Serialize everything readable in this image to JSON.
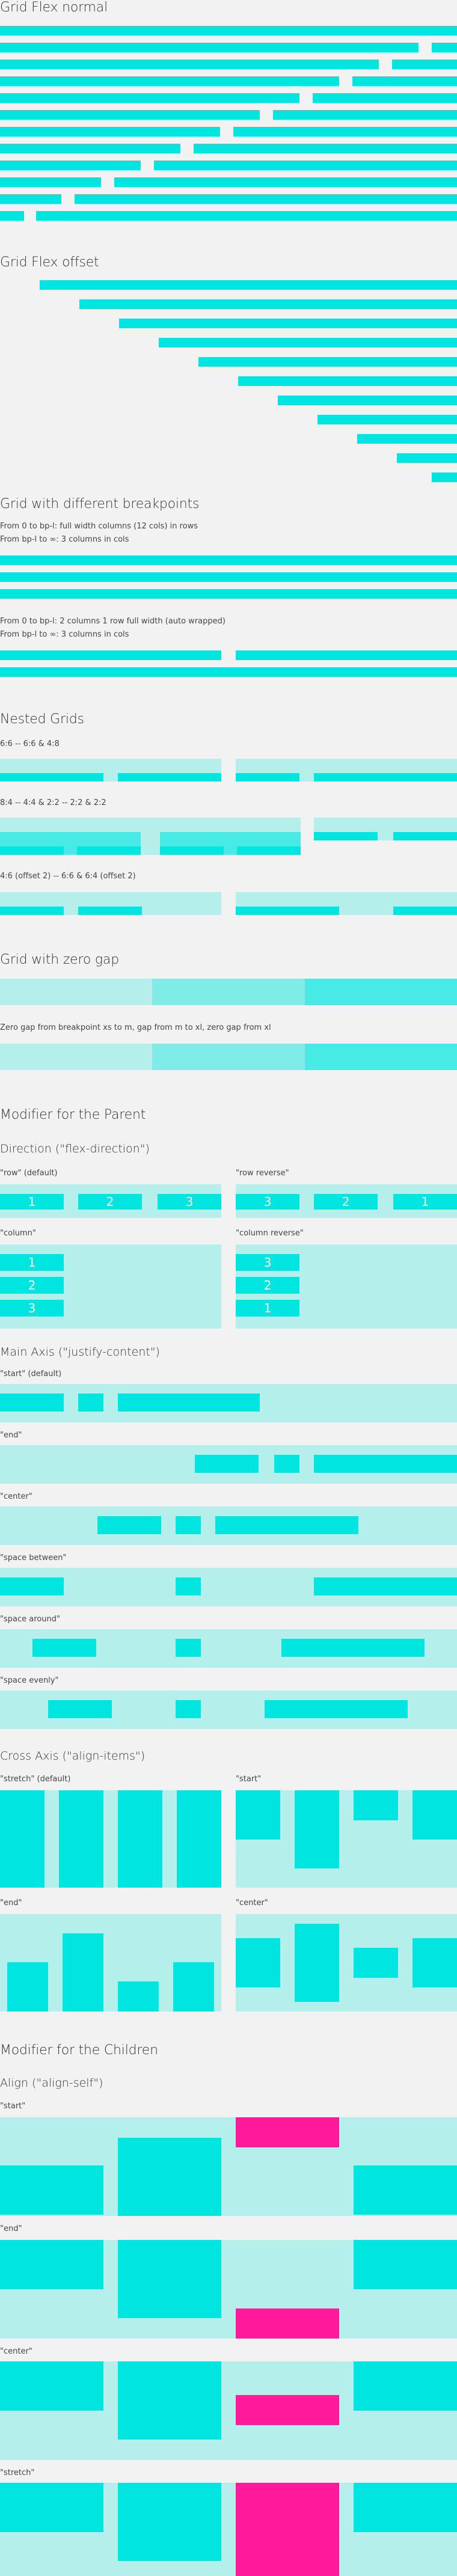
{
  "sections": {
    "grid_flex_normal": "Grid Flex normal",
    "grid_flex_offset": "Grid Flex offset",
    "breakpoints": {
      "title": "Grid with different breakpoints",
      "note1a": "From 0 to bp-l: full width columns (12 cols) in rows",
      "note1b": "From bp-l to ∞: 3 columns in cols",
      "note2a": "From 0 to bp-l: 2 columns 1 row full width (auto wrapped)",
      "note2b": "From bp-l to ∞: 3 columns in cols"
    },
    "nested": {
      "title": "Nested Grids",
      "label1": "6:6 -- 6:6 & 4:8",
      "label2": "8:4 -- 4:4 & 2:2 -- 2:2 & 2:2",
      "label3": "4:6 (offset 2) -- 6:6 & 6:4 (offset 2)"
    },
    "zero_gap": {
      "title": "Grid with zero gap",
      "note": "Zero gap from breakpoint xs to m, gap from m to xl, zero gap from xl"
    },
    "parent": {
      "title": "Modifier for the Parent",
      "direction": {
        "title": "Direction (\"flex-direction\")",
        "row": "\"row\" (default)",
        "row_reverse": "\"row reverse\"",
        "column": "\"column\"",
        "column_reverse": "\"column reverse\"",
        "items": [
          "1",
          "2",
          "3"
        ],
        "items_reverse": [
          "3",
          "2",
          "1"
        ]
      },
      "main_axis": {
        "title": "Main Axis (\"justify-content\")",
        "labels": [
          "\"start\" (default)",
          "\"end\"",
          "\"center\"",
          "\"space between\"",
          "\"space around\"",
          "\"space evenly\""
        ]
      },
      "cross_axis": {
        "title": "Cross Axis (\"align-items\")",
        "stretch": "\"stretch\" (default)",
        "start": "\"start\"",
        "end": "\"end\"",
        "center": "\"center\""
      }
    },
    "children": {
      "title": "Modifier for the Children",
      "align_self": {
        "title": "Align (\"align-self\")",
        "labels": [
          "\"start\"",
          "\"end\"",
          "\"center\"",
          "\"stretch\""
        ]
      }
    }
  },
  "colors": {
    "primary": "#00e5e0",
    "light": "#b4efec",
    "accent": "#ff1a9c",
    "background": "#f2f2f2"
  }
}
